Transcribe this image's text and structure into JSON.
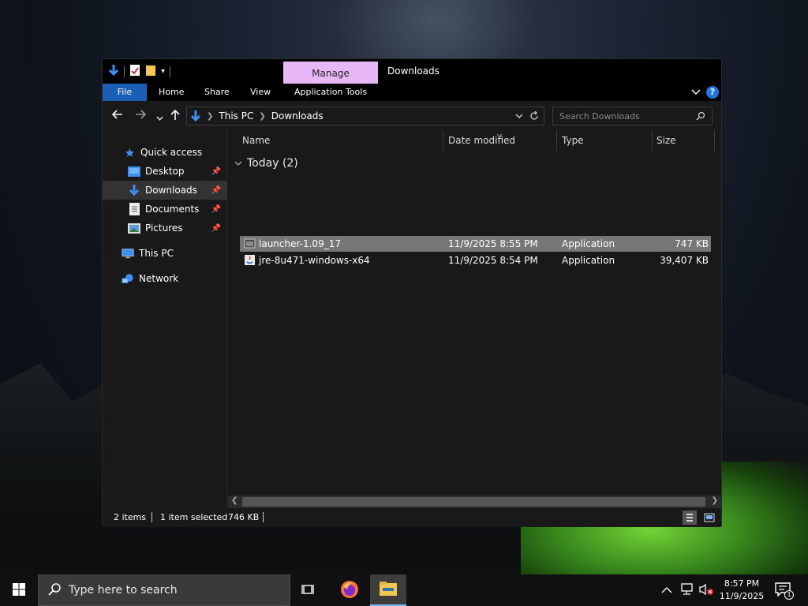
{
  "window": {
    "title": "Downloads",
    "context_tab": "Manage"
  },
  "ribbon": {
    "tabs": [
      "File",
      "Home",
      "Share",
      "View",
      "Application Tools"
    ]
  },
  "address": {
    "crumbs": [
      "This PC",
      "Downloads"
    ],
    "search_placeholder": "Search Downloads"
  },
  "nav": {
    "items": [
      {
        "label": "Quick access",
        "icon": "star-icon"
      },
      {
        "label": "Desktop",
        "icon": "desktop-folder-icon"
      },
      {
        "label": "Downloads",
        "icon": "downloads-folder-icon"
      },
      {
        "label": "Documents",
        "icon": "documents-folder-icon"
      },
      {
        "label": "Pictures",
        "icon": "pictures-folder-icon"
      },
      {
        "label": "This PC",
        "icon": "computer-icon"
      },
      {
        "label": "Network",
        "icon": "network-icon"
      }
    ],
    "selected": "Downloads"
  },
  "columns": [
    "Name",
    "Date modified",
    "Type",
    "Size"
  ],
  "group": {
    "label": "Today (2)"
  },
  "files": [
    {
      "name": "launcher-1.09_17",
      "date": "11/9/2025 8:55 PM",
      "type": "Application",
      "size": "747 KB",
      "selected": true
    },
    {
      "name": "jre-8u471-windows-x64",
      "date": "11/9/2025 8:54 PM",
      "type": "Application",
      "size": "39,407 KB",
      "selected": false
    }
  ],
  "status": {
    "items": "2 items",
    "selected": "1 item selected",
    "size": "746 KB"
  },
  "taskbar": {
    "search_placeholder": "Type here to search",
    "time": "8:57 PM",
    "date": "11/9/2025",
    "notification_count": "1"
  },
  "colors": {
    "accent": "#1a5fb4",
    "manage_tab": "#e8b8f6",
    "window_bg": "#191919"
  }
}
